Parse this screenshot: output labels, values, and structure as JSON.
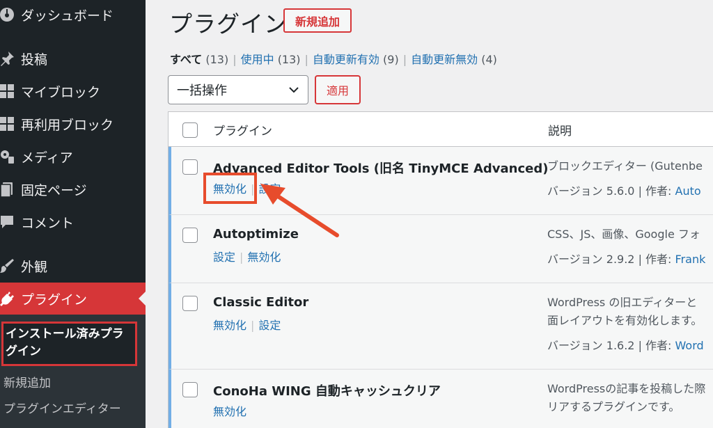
{
  "sidebar": {
    "items": [
      {
        "label": "ダッシュボード",
        "icon": "dashboard-icon"
      },
      {
        "label": "投稿",
        "icon": "pin-icon"
      },
      {
        "label": "マイブロック",
        "icon": "grid-icon"
      },
      {
        "label": "再利用ブロック",
        "icon": "grid-icon"
      },
      {
        "label": "メディア",
        "icon": "media-icon"
      },
      {
        "label": "固定ページ",
        "icon": "page-icon"
      },
      {
        "label": "コメント",
        "icon": "comment-icon"
      },
      {
        "label": "外観",
        "icon": "brush-icon"
      },
      {
        "label": "プラグイン",
        "icon": "plug-icon"
      }
    ],
    "submenu": {
      "current": "インストール済みプラグイン",
      "items": [
        "新規追加",
        "プラグインエディター"
      ]
    }
  },
  "page": {
    "title": "プラグイン",
    "add_new": "新規追加"
  },
  "filters": {
    "all": "すべて",
    "all_count": "(13)",
    "active": "使用中",
    "active_count": "(13)",
    "auto_on": "自動更新有効",
    "auto_on_count": "(9)",
    "auto_off": "自動更新無効",
    "auto_off_count": "(4)"
  },
  "bulk": {
    "select": "一括操作",
    "apply": "適用"
  },
  "table": {
    "col_plugin": "プラグイン",
    "col_desc": "説明",
    "rows": [
      {
        "name": "Advanced Editor Tools (旧名 TinyMCE Advanced)",
        "action1": "無効化",
        "action2": "設定",
        "desc1": "ブロックエディター (Gutenbe",
        "version": "バージョン 5.6.0 | 作者: ",
        "author": "Auto"
      },
      {
        "name": "Autoptimize",
        "action1": "設定",
        "action2": "無効化",
        "desc1": "CSS、JS、画像、Google フォ",
        "version": "バージョン 2.9.2 | 作者: ",
        "author": "Frank"
      },
      {
        "name": "Classic Editor",
        "action1": "無効化",
        "action2": "設定",
        "desc1": "WordPress の旧エディターと",
        "desc2": "面レイアウトを有効化します。",
        "version": "バージョン 1.6.2 | 作者: ",
        "author": "Word"
      },
      {
        "name": "ConoHa WING 自動キャッシュクリア",
        "action1": "無効化",
        "desc1": "WordPressの記事を投稿した際",
        "desc2": "リアするプラグインです。"
      }
    ]
  },
  "colors": {
    "sidebar_bg": "#1d2327",
    "active_menu": "#d63638",
    "link": "#2271b1",
    "annotation_red": "#e74c2c"
  }
}
